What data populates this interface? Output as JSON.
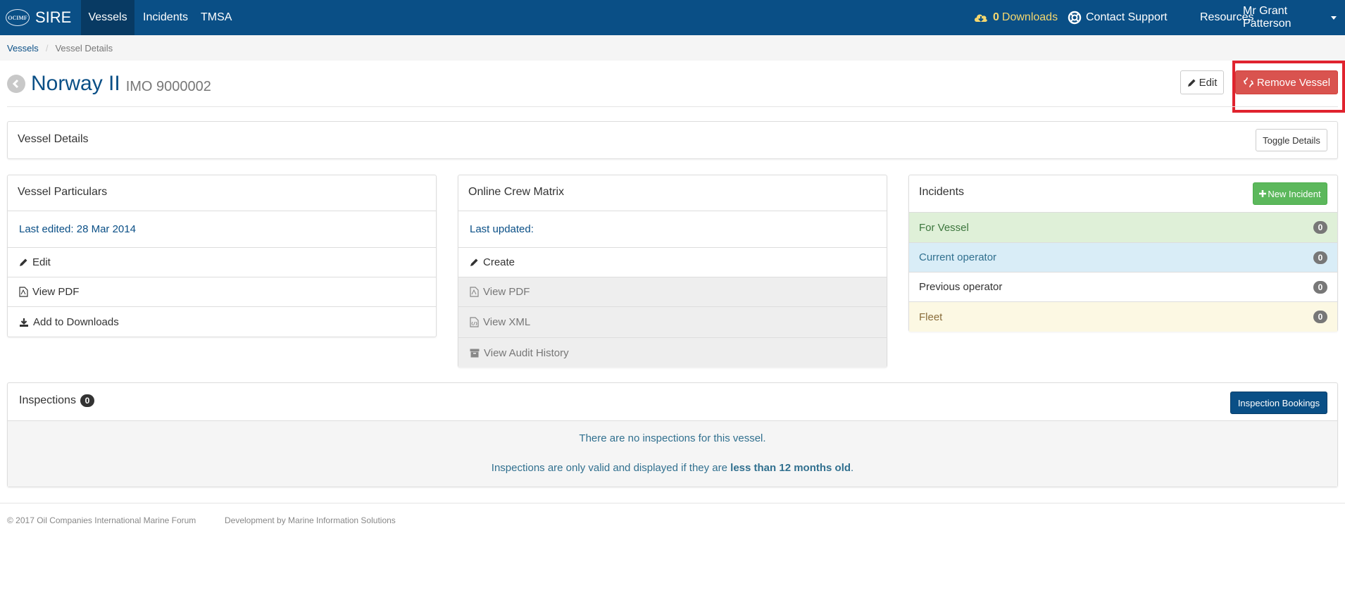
{
  "navbar": {
    "brand_logo": "OCIMF",
    "brand": "SIRE",
    "nav_items": [
      "Vessels",
      "Incidents",
      "TMSA"
    ],
    "downloads_count": "0",
    "downloads_label": "Downloads",
    "contact_support": "Contact Support",
    "resources": "Resources",
    "user": "Mr Grant Patterson",
    "colors": {
      "bar": "#0a4f86",
      "active": "#083a63",
      "downloads": "#f5d76e"
    }
  },
  "breadcrumb": {
    "parent": "Vessels",
    "separator": "/",
    "current": "Vessel Details"
  },
  "header": {
    "vessel_name": "Norway II",
    "imo": "IMO 9000002",
    "edit_label": "Edit",
    "remove_label": "Remove Vessel"
  },
  "vessel_details": {
    "title": "Vessel Details",
    "toggle_label": "Toggle Details"
  },
  "particulars": {
    "title": "Vessel Particulars",
    "last_edited": "Last edited: 28 Mar 2014",
    "items": [
      {
        "label": "Edit",
        "icon": "pencil-icon"
      },
      {
        "label": "View PDF",
        "icon": "pdf-file-icon"
      },
      {
        "label": "Add to Downloads",
        "icon": "download-icon"
      }
    ]
  },
  "crew_matrix": {
    "title": "Online Crew Matrix",
    "last_updated": "Last updated:",
    "items": [
      {
        "label": "Create",
        "icon": "pencil-icon"
      },
      {
        "label": "View PDF",
        "icon": "pdf-file-icon"
      },
      {
        "label": "View XML",
        "icon": "xml-file-icon"
      },
      {
        "label": "View Audit History",
        "icon": "archive-icon"
      }
    ]
  },
  "incidents": {
    "title": "Incidents",
    "new_label": "New Incident",
    "rows": [
      {
        "label": "For Vessel",
        "count": "0",
        "bg": "#dff0d8",
        "color": "#3c763d"
      },
      {
        "label": "Current operator",
        "count": "0",
        "bg": "#d9edf7",
        "color": "#31708f"
      },
      {
        "label": "Previous operator",
        "count": "0",
        "bg": "#ffffff",
        "color": "#333333"
      },
      {
        "label": "Fleet",
        "count": "0",
        "bg": "#fcf8e3",
        "color": "#8a6d3b"
      }
    ]
  },
  "inspections": {
    "title": "Inspections",
    "count": "0",
    "bookings_label": "Inspection Bookings",
    "empty_message": "There are no inspections for this vessel.",
    "validity_prefix": "Inspections are only valid and displayed if they are ",
    "validity_bold": "less than 12 months old",
    "validity_suffix": "."
  },
  "footer": {
    "copyright": "© 2017 Oil Companies International Marine Forum",
    "developer": "Development by Marine Information Solutions"
  }
}
